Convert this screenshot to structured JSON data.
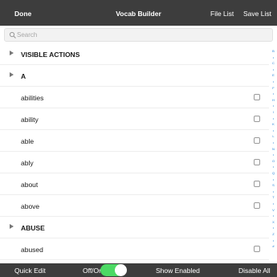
{
  "topbar": {
    "done": "Done",
    "title": "Vocab Builder",
    "file_list": "File List",
    "save_list": "Save List"
  },
  "search": {
    "placeholder": "Search",
    "value": ""
  },
  "rows": [
    {
      "label": "VISIBLE ACTIONS",
      "type": "section"
    },
    {
      "label": "A",
      "type": "section"
    },
    {
      "label": "abilities",
      "type": "word",
      "checked": false
    },
    {
      "label": "ability",
      "type": "word",
      "checked": false
    },
    {
      "label": "able",
      "type": "word",
      "checked": false
    },
    {
      "label": "ably",
      "type": "word",
      "checked": false
    },
    {
      "label": "about",
      "type": "word",
      "checked": false
    },
    {
      "label": "above",
      "type": "word",
      "checked": false
    },
    {
      "label": "ABUSE",
      "type": "section"
    },
    {
      "label": "abused",
      "type": "word",
      "checked": false
    }
  ],
  "index_letters": [
    "B",
    "C",
    "E",
    "F",
    "H",
    "I",
    "K",
    "L",
    "N",
    "O",
    "Q",
    "S",
    "T",
    "V",
    "X",
    "Z",
    "#"
  ],
  "bottombar": {
    "quick_edit": "Quick Edit",
    "off_on": "Off/On",
    "toggle_on": true,
    "show_enabled": "Show Enabled",
    "disable_all": "Disable All"
  },
  "colors": {
    "bar_background": "#3d3d3d",
    "toggle_on": "#4cd964",
    "index_accent": "#1e7fd8"
  }
}
